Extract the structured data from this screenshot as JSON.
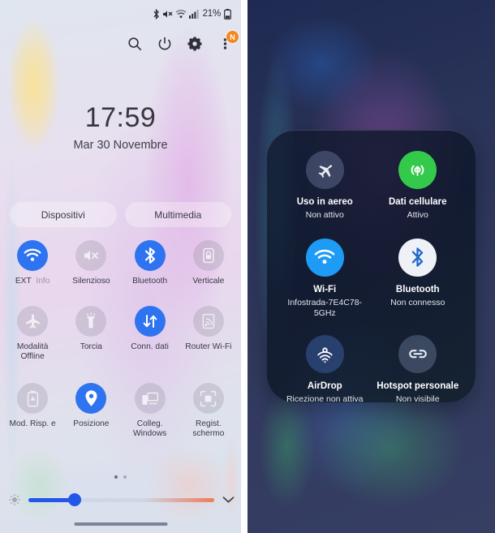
{
  "android": {
    "status_bar": {
      "icons": [
        "bluetooth-icon",
        "mute-icon",
        "wifi-icon",
        "signal-icon"
      ],
      "battery_percent": "21%",
      "battery_icon": "battery-icon"
    },
    "header_icons": [
      {
        "name": "search-icon",
        "label": "Cerca"
      },
      {
        "name": "power-icon",
        "label": "Spegni"
      },
      {
        "name": "settings-gear-icon",
        "label": "Impostazioni"
      },
      {
        "name": "overflow-menu-icon",
        "label": "Altro",
        "badge": "N"
      }
    ],
    "clock": {
      "time": "17:59",
      "date": "Mar 30 Novembre"
    },
    "pills": [
      {
        "label": "Dispositivi"
      },
      {
        "label": "Multimedia"
      }
    ],
    "tiles": [
      [
        {
          "label": "EXT",
          "sub_label": "Info",
          "icon": "wifi-icon",
          "state": "on"
        },
        {
          "label": "Silenzioso",
          "icon": "mute-icon",
          "state": "off"
        },
        {
          "label": "Bluetooth",
          "icon": "bluetooth-icon",
          "state": "on"
        },
        {
          "label": "Verticale",
          "icon": "rotation-lock-icon",
          "state": "off"
        }
      ],
      [
        {
          "label": "Modalità Offline",
          "icon": "airplane-icon",
          "state": "off"
        },
        {
          "label": "Torcia",
          "icon": "flashlight-icon",
          "state": "off"
        },
        {
          "label": "Conn. dati",
          "icon": "data-transfer-icon",
          "state": "on"
        },
        {
          "label": "Router Wi-Fi",
          "icon": "hotspot-icon",
          "state": "off"
        }
      ],
      [
        {
          "label": "Mod. Risp. e",
          "icon": "battery-saver-icon",
          "state": "off"
        },
        {
          "label": "Posizione",
          "icon": "location-pin-icon",
          "state": "on"
        },
        {
          "label": "Colleg. Windows",
          "icon": "link-to-windows-icon",
          "state": "off"
        },
        {
          "label": "Regist. schermo",
          "icon": "screen-record-icon",
          "state": "off"
        }
      ]
    ],
    "page_dots": {
      "count": 2,
      "active_index": 0
    },
    "brightness": {
      "icon": "brightness-icon",
      "value_percent": 25,
      "expand_icon": "chevron-down-icon"
    },
    "home_indicator": "home-indicator",
    "colors": {
      "accent": "#2e74f0",
      "slider_fill": "#2257e8",
      "badge": "#f5871f"
    }
  },
  "ios": {
    "control_center": {
      "rows": [
        [
          {
            "title": "Uso in aereo",
            "subtitle": "Non attivo",
            "icon": "airplane-icon",
            "style": "grey"
          },
          {
            "title": "Dati cellulare",
            "subtitle": "Attivo",
            "icon": "cellular-data-icon",
            "style": "green"
          }
        ],
        [
          {
            "title": "Wi-Fi",
            "subtitle": "Infostrada-7E4C78-5GHz",
            "icon": "wifi-icon",
            "style": "blue"
          },
          {
            "title": "Bluetooth",
            "subtitle": "Non connesso",
            "icon": "bluetooth-icon",
            "style": "white"
          }
        ],
        [
          {
            "title": "AirDrop",
            "subtitle": "Ricezione non attiva",
            "icon": "airdrop-icon",
            "style": "dim"
          },
          {
            "title": "Hotspot personale",
            "subtitle": "Non visibile",
            "icon": "personal-hotspot-icon",
            "style": "grey"
          }
        ]
      ]
    },
    "colors": {
      "green": "#33c94b",
      "blue": "#1d9bf5",
      "white": "#eef1f6"
    }
  }
}
